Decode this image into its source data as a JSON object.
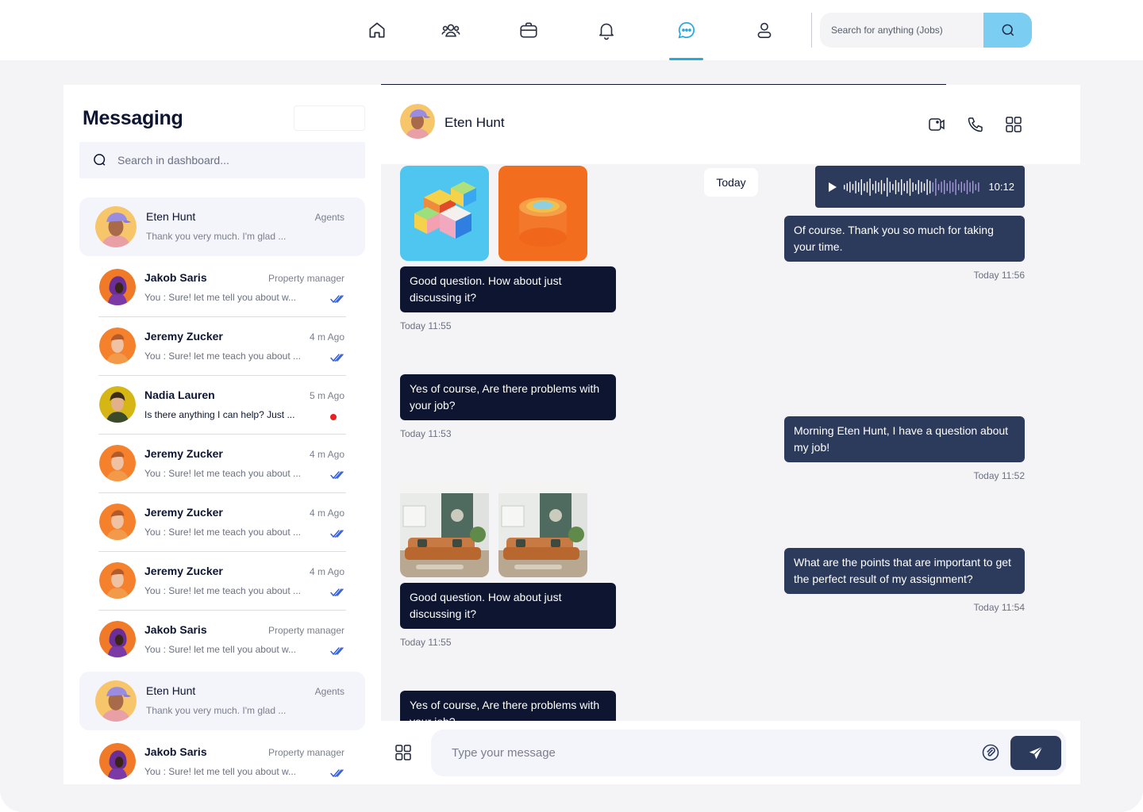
{
  "colors": {
    "accent": "#29a8e0",
    "search_button": "#7ccdf2",
    "bubble_incoming": "#0d1530",
    "bubble_outgoing": "#2c3a5c",
    "unread_dot": "#e8201e",
    "read_check": "#2f5bd8"
  },
  "topnav": {
    "icons": [
      "home-icon",
      "people-icon",
      "briefcase-icon",
      "bell-icon",
      "chat-icon",
      "user-icon"
    ],
    "active": "chat-icon",
    "search_placeholder": "Search for anything (Jobs)"
  },
  "sidebar": {
    "title": "Messaging",
    "search_placeholder": "Search in dashboard...",
    "conversations": [
      {
        "name": "Eten Hunt",
        "meta": "Agents",
        "preview": "Thank you very much. I'm glad ...",
        "active": true,
        "status": "none"
      },
      {
        "name": "Jakob Saris",
        "meta": "Property manager",
        "preview": "You : Sure! let me tell you about w...",
        "active": false,
        "status": "read"
      },
      {
        "name": "Jeremy Zucker",
        "meta": "4 m Ago",
        "preview": "You : Sure! let me teach you about ...",
        "active": false,
        "status": "read"
      },
      {
        "name": "Nadia Lauren",
        "meta": "5 m Ago",
        "preview": "Is there anything I can help? Just ...",
        "active": false,
        "status": "unread"
      },
      {
        "name": "Jeremy Zucker",
        "meta": "4 m Ago",
        "preview": "You : Sure! let me teach you about ...",
        "active": false,
        "status": "read"
      },
      {
        "name": "Jeremy Zucker",
        "meta": "4 m Ago",
        "preview": "You : Sure! let me teach you about ...",
        "active": false,
        "status": "read"
      },
      {
        "name": "Jeremy Zucker",
        "meta": "4 m Ago",
        "preview": "You : Sure! let me teach you about ...",
        "active": false,
        "status": "read"
      },
      {
        "name": "Jakob Saris",
        "meta": "Property manager",
        "preview": "You : Sure! let me tell you about w...",
        "active": false,
        "status": "read"
      },
      {
        "name": "Eten Hunt",
        "meta": "Agents",
        "preview": "Thank you very much. I'm glad ...",
        "active": true,
        "status": "none"
      },
      {
        "name": "Jakob Saris",
        "meta": "Property manager",
        "preview": "You : Sure! let me tell you about w...",
        "active": false,
        "status": "read"
      }
    ]
  },
  "chat": {
    "contact_name": "Eten Hunt",
    "header_icons": [
      "video-call-icon",
      "phone-icon",
      "grid-icon"
    ],
    "day_label": "Today",
    "voice_message": {
      "duration": "10:12"
    },
    "messages": [
      {
        "direction": "in",
        "images": [
          "cube-image",
          "cylinder-image"
        ],
        "text": "Good question. How about just discussing it?",
        "time": "Today 11:55"
      },
      {
        "direction": "out",
        "text": "Of course. Thank you so much for taking your time.",
        "time": "Today 11:56"
      },
      {
        "direction": "in",
        "text": "Yes of course, Are there problems with your job?",
        "time": "Today 11:53"
      },
      {
        "direction": "out",
        "text": "Morning Eten Hunt, I have a question about my job!",
        "time": "Today 11:52"
      },
      {
        "direction": "in",
        "images": [
          "living-room-image",
          "living-room-image"
        ],
        "text": "Good question. How about just discussing it?",
        "time": "Today 11:55"
      },
      {
        "direction": "out",
        "text": "What are the points that are important to get the perfect result of my assignment?",
        "time": "Today 11:54"
      },
      {
        "direction": "in",
        "text": "Yes of course, Are there problems with your job?",
        "time": ""
      }
    ]
  },
  "composer": {
    "placeholder": "Type your message"
  }
}
